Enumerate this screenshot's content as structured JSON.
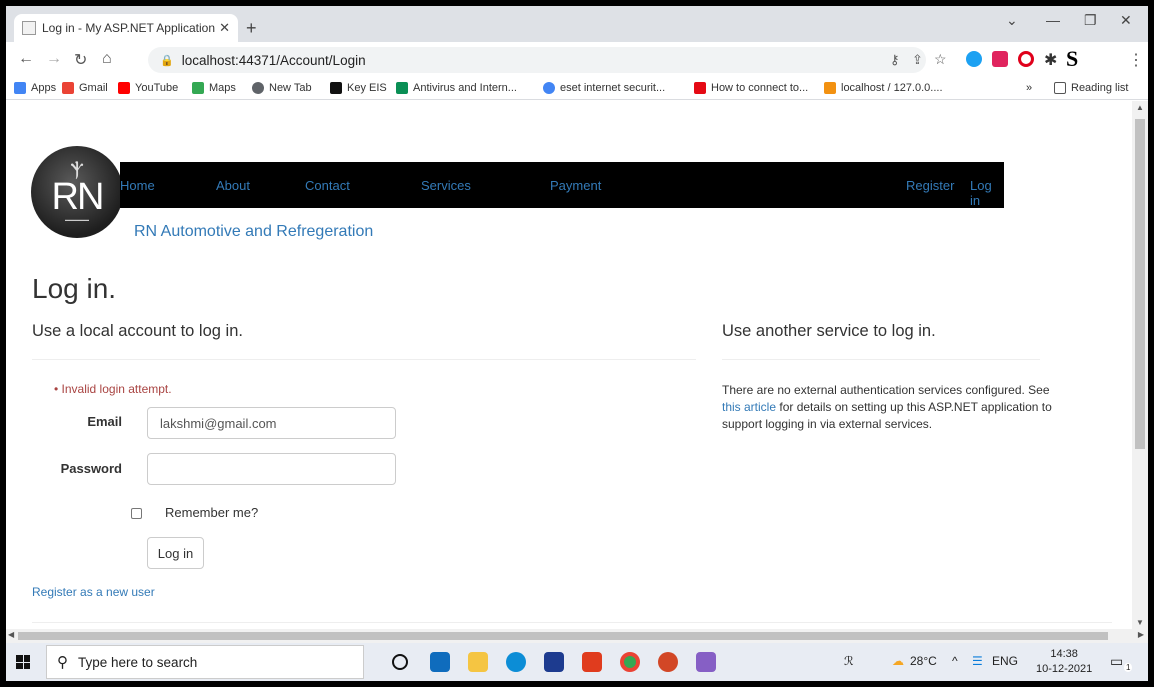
{
  "browser": {
    "tab_title": "Log in - My ASP.NET Application",
    "tab_close": "✕",
    "new_tab": "+",
    "address": "localhost:44371/Account/Login",
    "bookmarks": [
      {
        "label": "Apps",
        "color": "#4285f4"
      },
      {
        "label": "Gmail",
        "color": "#ea4335"
      },
      {
        "label": "YouTube",
        "color": "#ff0000"
      },
      {
        "label": "Maps",
        "color": "#34a853"
      },
      {
        "label": "New Tab",
        "color": "#5f6368"
      },
      {
        "label": "Key EIS",
        "color": "#111111"
      },
      {
        "label": "Antivirus and Intern...",
        "color": "#0a8f55"
      },
      {
        "label": "eset internet securit...",
        "color": "#4285f4"
      },
      {
        "label": "How to connect to...",
        "color": "#e50914"
      },
      {
        "label": "localhost / 127.0.0....",
        "color": "#f29111"
      }
    ],
    "bookmarks_more": "»",
    "reading_list": "Reading list",
    "extension_s": "S"
  },
  "site": {
    "logo_text": "RN",
    "nav": {
      "home": "Home",
      "about": "About",
      "contact": "Contact",
      "services": "Services",
      "payment": "Payment",
      "register": "Register",
      "login": "Log in"
    },
    "brand": "RN Automotive and Refregeration"
  },
  "login": {
    "heading": "Log in.",
    "local_heading": "Use a local account to log in.",
    "error": "• Invalid login attempt.",
    "email_label": "Email",
    "email_value": "lakshmi@gmail.com",
    "password_label": "Password",
    "password_value": "",
    "remember_label": "Remember me?",
    "submit_label": "Log in",
    "register_link": "Register as a new user"
  },
  "external": {
    "heading": "Use another service to log in.",
    "text_before": "There are no external authentication services configured. See ",
    "link_text": "this article",
    "text_after": " for details on setting up this ASP.NET application to support logging in via external services."
  },
  "taskbar": {
    "search_placeholder": "Type here to search",
    "weather": "28°C",
    "language": "ENG",
    "time": "14:38",
    "date": "10-12-2021",
    "notification_count": "1"
  }
}
